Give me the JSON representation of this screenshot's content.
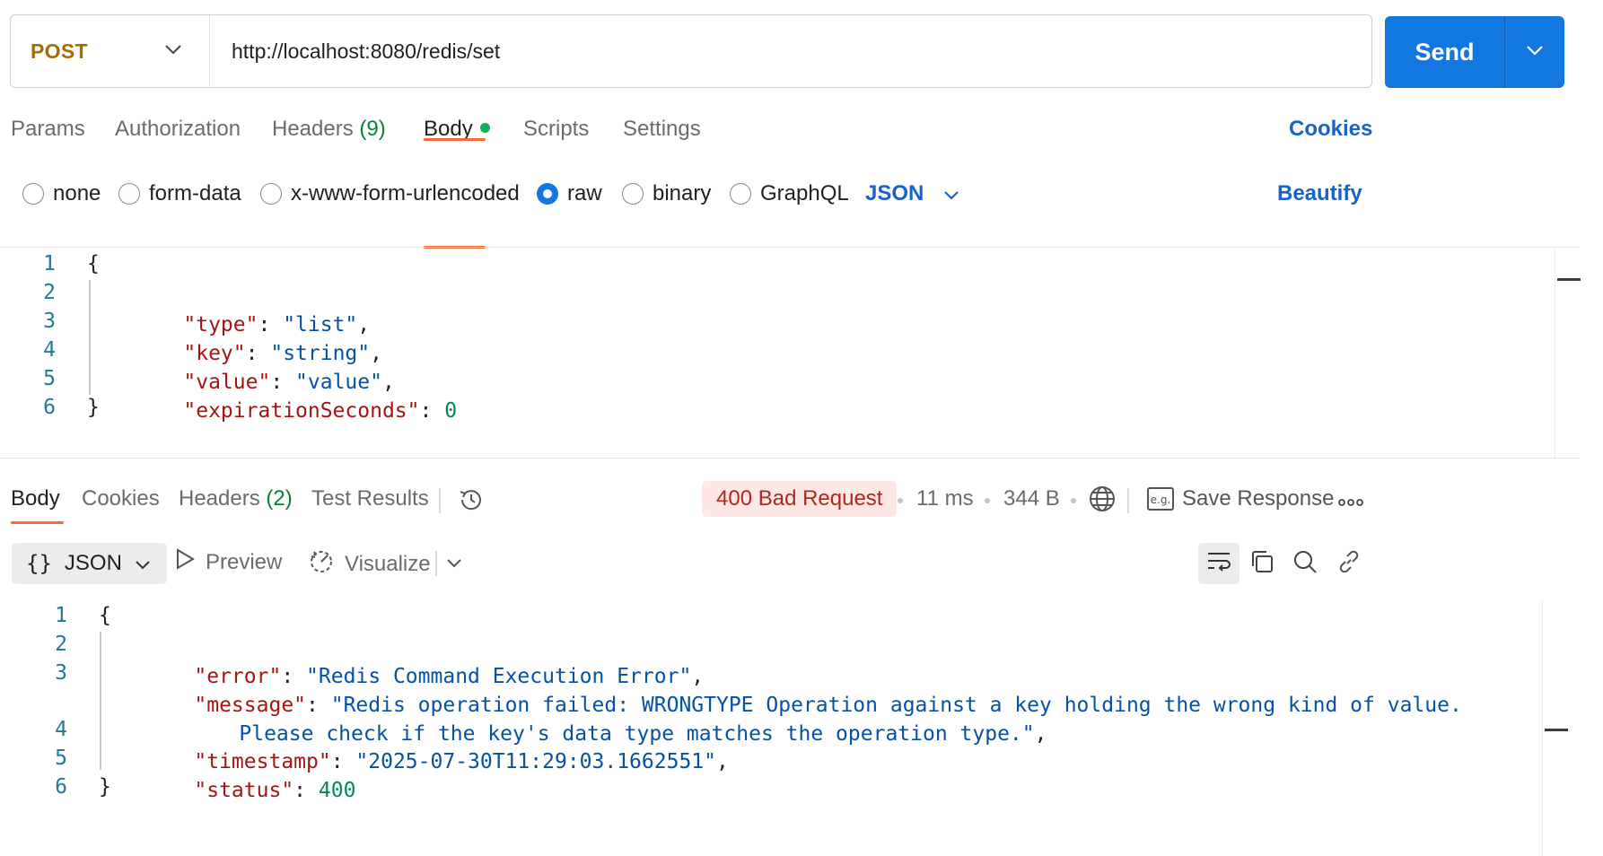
{
  "request": {
    "method": "POST",
    "url": "http://localhost:8080/redis/set",
    "send_label": "Send"
  },
  "request_tabs": {
    "params": "Params",
    "authorization": "Authorization",
    "headers_label": "Headers",
    "headers_count": "(9)",
    "body": "Body",
    "scripts": "Scripts",
    "settings": "Settings",
    "cookies": "Cookies"
  },
  "body_types": {
    "none": "none",
    "form_data": "form-data",
    "urlencoded": "x-www-form-urlencoded",
    "raw": "raw",
    "binary": "binary",
    "graphql": "GraphQL",
    "selected": "raw",
    "language": "JSON",
    "beautify": "Beautify"
  },
  "request_body": {
    "line_numbers": [
      "1",
      "2",
      "3",
      "4",
      "5",
      "6"
    ],
    "open_brace": "{",
    "close_brace": "}",
    "fields": [
      {
        "key": "\"type\"",
        "value": "\"list\"",
        "kind": "string",
        "comma": ","
      },
      {
        "key": "\"key\"",
        "value": "\"string\"",
        "kind": "string",
        "comma": ","
      },
      {
        "key": "\"value\"",
        "value": "\"value\"",
        "kind": "string",
        "comma": ","
      },
      {
        "key": "\"expirationSeconds\"",
        "value": "0",
        "kind": "number",
        "comma": ""
      }
    ]
  },
  "response_tabs": {
    "body": "Body",
    "cookies": "Cookies",
    "headers_label": "Headers",
    "headers_count": "(2)",
    "test_results": "Test Results"
  },
  "response_meta": {
    "status": "400 Bad Request",
    "time": "11 ms",
    "size": "344 B",
    "save_response": "Save Response",
    "status_color": "#b1271b"
  },
  "response_toolbar": {
    "format": "JSON",
    "preview": "Preview",
    "visualize": "Visualize"
  },
  "response_body": {
    "line_numbers": [
      "1",
      "2",
      "3",
      "",
      "4",
      "5",
      "6"
    ],
    "open_brace": "{",
    "close_brace": "}",
    "error_key": "\"error\"",
    "error_value": "\"Redis Command Execution Error\"",
    "message_key": "\"message\"",
    "message_value_1": "\"Redis operation failed: WRONGTYPE Operation against a key holding the wrong kind of value.",
    "message_value_2": "Please check if the key's data type matches the operation type.\"",
    "timestamp_key": "\"timestamp\"",
    "timestamp_value": "\"2025-07-30T11:29:03.1662551\"",
    "status_key": "\"status\"",
    "status_value": "400"
  },
  "colors": {
    "accent_blue": "#1377e0",
    "tab_underline": "#f26b3a",
    "body_dot": "#0cb35a",
    "method_color": "#a66d00"
  }
}
